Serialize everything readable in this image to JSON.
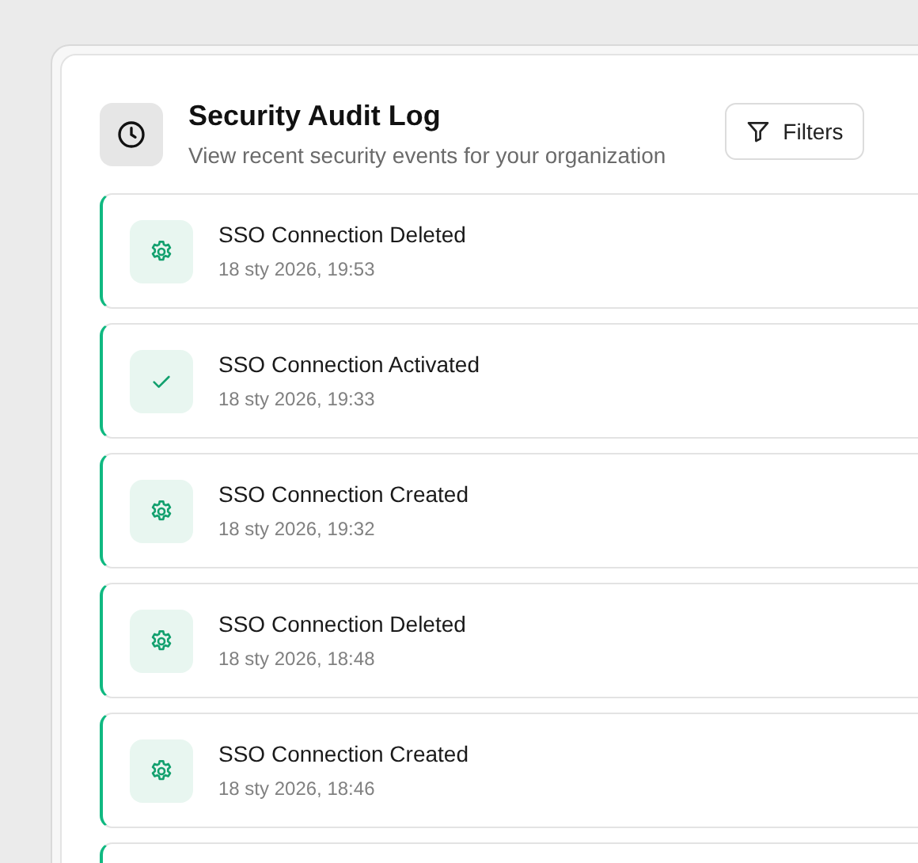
{
  "header": {
    "title": "Security Audit Log",
    "subtitle": "View recent security events for your organization",
    "filter_button": "Filters"
  },
  "events": [
    {
      "kind": "settings",
      "title": "SSO Connection Deleted",
      "time": "18 sty 2026, 19:53"
    },
    {
      "kind": "success",
      "title": "SSO Connection Activated",
      "time": "18 sty 2026, 19:33"
    },
    {
      "kind": "settings",
      "title": "SSO Connection Created",
      "time": "18 sty 2026, 19:32"
    },
    {
      "kind": "settings",
      "title": "SSO Connection Deleted",
      "time": "18 sty 2026, 18:48"
    },
    {
      "kind": "settings",
      "title": "SSO Connection Created",
      "time": "18 sty 2026, 18:46"
    }
  ]
}
